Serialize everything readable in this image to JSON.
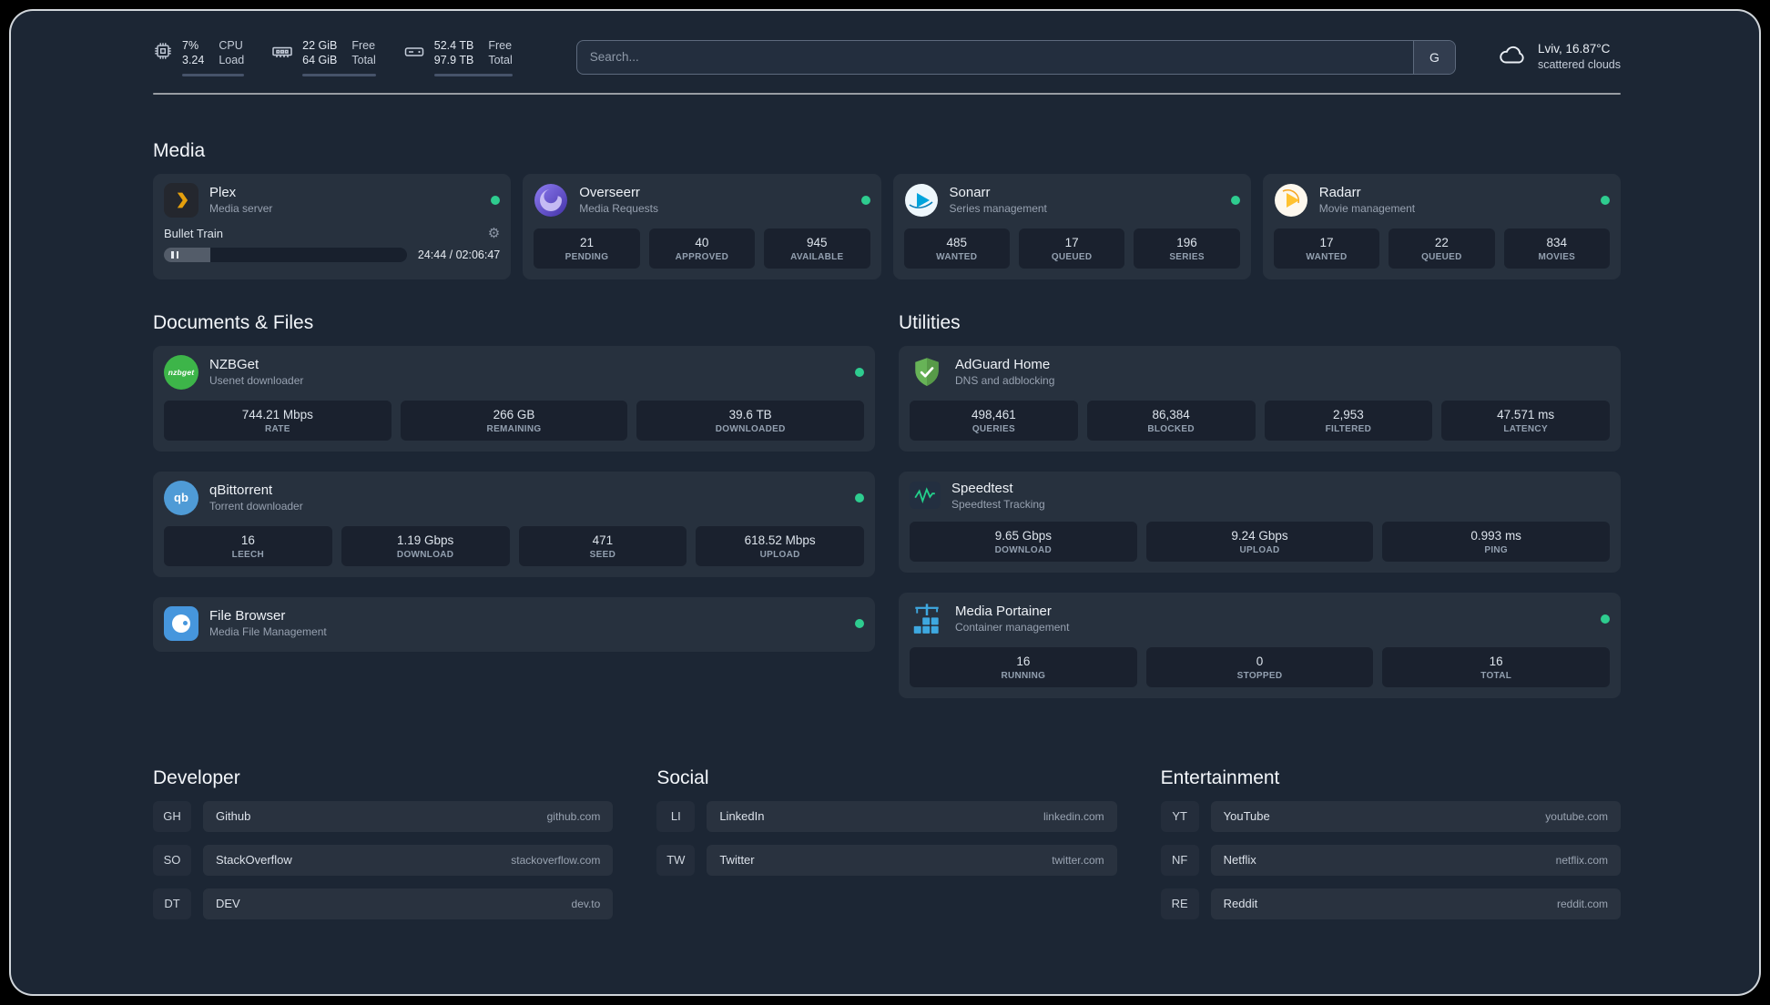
{
  "colors": {
    "status_online": "#2ecc8f",
    "plex": "#e5a00d",
    "overseerr": "#5848c4",
    "sonarr": "#00a4dc",
    "radarr": "#ffc230",
    "nzbget": "#3db549",
    "qbittorrent": "#4f9bd6",
    "filebrowser": "#4696dd",
    "adguard": "#67b357",
    "speedtest": "#23d18b",
    "portainer": "#3ea8e0"
  },
  "topbar": {
    "resources": [
      {
        "icon": "cpu",
        "top_value": "7%",
        "bottom_value": "3.24",
        "top_label": "CPU",
        "bottom_label": "Load",
        "progress": 7
      },
      {
        "icon": "memory",
        "top_value": "22 GiB",
        "bottom_value": "64 GiB",
        "top_label": "Free",
        "bottom_label": "Total",
        "progress": 66
      },
      {
        "icon": "disk",
        "top_value": "52.4 TB",
        "bottom_value": "97.9 TB",
        "top_label": "Free",
        "bottom_label": "Total",
        "progress": 46
      }
    ],
    "search": {
      "placeholder": "Search...",
      "provider_button": "G"
    },
    "weather": {
      "location": "Lviv, 16.87°C",
      "condition": "scattered clouds"
    }
  },
  "sections": {
    "media": "Media",
    "documents": "Documents & Files",
    "utilities": "Utilities",
    "developer": "Developer",
    "social": "Social",
    "entertainment": "Entertainment"
  },
  "cards": {
    "plex": {
      "name": "Plex",
      "subtitle": "Media server",
      "player": {
        "title": "Bullet Train",
        "time": "24:44 / 02:06:47",
        "progress": 19
      }
    },
    "overseerr": {
      "name": "Overseerr",
      "subtitle": "Media Requests",
      "stats": [
        {
          "value": "21",
          "label": "PENDING"
        },
        {
          "value": "40",
          "label": "APPROVED"
        },
        {
          "value": "945",
          "label": "AVAILABLE"
        }
      ]
    },
    "sonarr": {
      "name": "Sonarr",
      "subtitle": "Series management",
      "stats": [
        {
          "value": "485",
          "label": "WANTED"
        },
        {
          "value": "17",
          "label": "QUEUED"
        },
        {
          "value": "196",
          "label": "SERIES"
        }
      ]
    },
    "radarr": {
      "name": "Radarr",
      "subtitle": "Movie management",
      "stats": [
        {
          "value": "17",
          "label": "WANTED"
        },
        {
          "value": "22",
          "label": "QUEUED"
        },
        {
          "value": "834",
          "label": "MOVIES"
        }
      ]
    },
    "nzbget": {
      "name": "NZBGet",
      "subtitle": "Usenet downloader",
      "icon_text": "nzbget",
      "stats": [
        {
          "value": "744.21 Mbps",
          "label": "RATE"
        },
        {
          "value": "266 GB",
          "label": "REMAINING"
        },
        {
          "value": "39.6 TB",
          "label": "DOWNLOADED"
        }
      ]
    },
    "qbittorrent": {
      "name": "qBittorrent",
      "subtitle": "Torrent downloader",
      "icon_text": "qb",
      "stats": [
        {
          "value": "16",
          "label": "LEECH"
        },
        {
          "value": "1.19 Gbps",
          "label": "DOWNLOAD"
        },
        {
          "value": "471",
          "label": "SEED"
        },
        {
          "value": "618.52 Mbps",
          "label": "UPLOAD"
        }
      ]
    },
    "filebrowser": {
      "name": "File Browser",
      "subtitle": "Media File Management"
    },
    "adguard": {
      "name": "AdGuard Home",
      "subtitle": "DNS and adblocking",
      "stats": [
        {
          "value": "498,461",
          "label": "QUERIES"
        },
        {
          "value": "86,384",
          "label": "BLOCKED"
        },
        {
          "value": "2,953",
          "label": "FILTERED"
        },
        {
          "value": "47.571 ms",
          "label": "LATENCY"
        }
      ]
    },
    "speedtest": {
      "name": "Speedtest",
      "subtitle": "Speedtest Tracking",
      "stats": [
        {
          "value": "9.65 Gbps",
          "label": "DOWNLOAD"
        },
        {
          "value": "9.24 Gbps",
          "label": "UPLOAD"
        },
        {
          "value": "0.993 ms",
          "label": "PING"
        }
      ]
    },
    "portainer": {
      "name": "Media Portainer",
      "subtitle": "Container management",
      "stats": [
        {
          "value": "16",
          "label": "RUNNING"
        },
        {
          "value": "0",
          "label": "STOPPED"
        },
        {
          "value": "16",
          "label": "TOTAL"
        }
      ]
    }
  },
  "bookmarks": {
    "developer": [
      {
        "abbr": "GH",
        "name": "Github",
        "domain": "github.com"
      },
      {
        "abbr": "SO",
        "name": "StackOverflow",
        "domain": "stackoverflow.com"
      },
      {
        "abbr": "DT",
        "name": "DEV",
        "domain": "dev.to"
      }
    ],
    "social": [
      {
        "abbr": "LI",
        "name": "LinkedIn",
        "domain": "linkedin.com"
      },
      {
        "abbr": "TW",
        "name": "Twitter",
        "domain": "twitter.com"
      }
    ],
    "entertainment": [
      {
        "abbr": "YT",
        "name": "YouTube",
        "domain": "youtube.com"
      },
      {
        "abbr": "NF",
        "name": "Netflix",
        "domain": "netflix.com"
      },
      {
        "abbr": "RE",
        "name": "Reddit",
        "domain": "reddit.com"
      }
    ]
  }
}
